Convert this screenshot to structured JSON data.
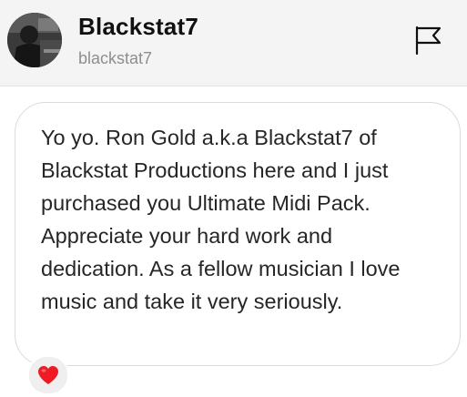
{
  "header": {
    "display_name": "Blackstat7",
    "username": "blackstat7",
    "avatar_icon": "profile-photo",
    "flag_icon": "flag-outline-icon"
  },
  "message": {
    "text": "Yo yo. Ron Gold a.k.a Blackstat7 of Blackstat Productions here and I just purchased you Ultimate Midi Pack. Appreciate your hard work and dedication. As a fellow musician I love music and take it very seriously."
  },
  "reaction": {
    "icon": "red-heart-icon",
    "color": "#ed1c24"
  },
  "colors": {
    "header_bg": "#f4f4f4",
    "bubble_border": "#dbdbdb",
    "text": "#262626",
    "username": "#8e8e8e"
  }
}
